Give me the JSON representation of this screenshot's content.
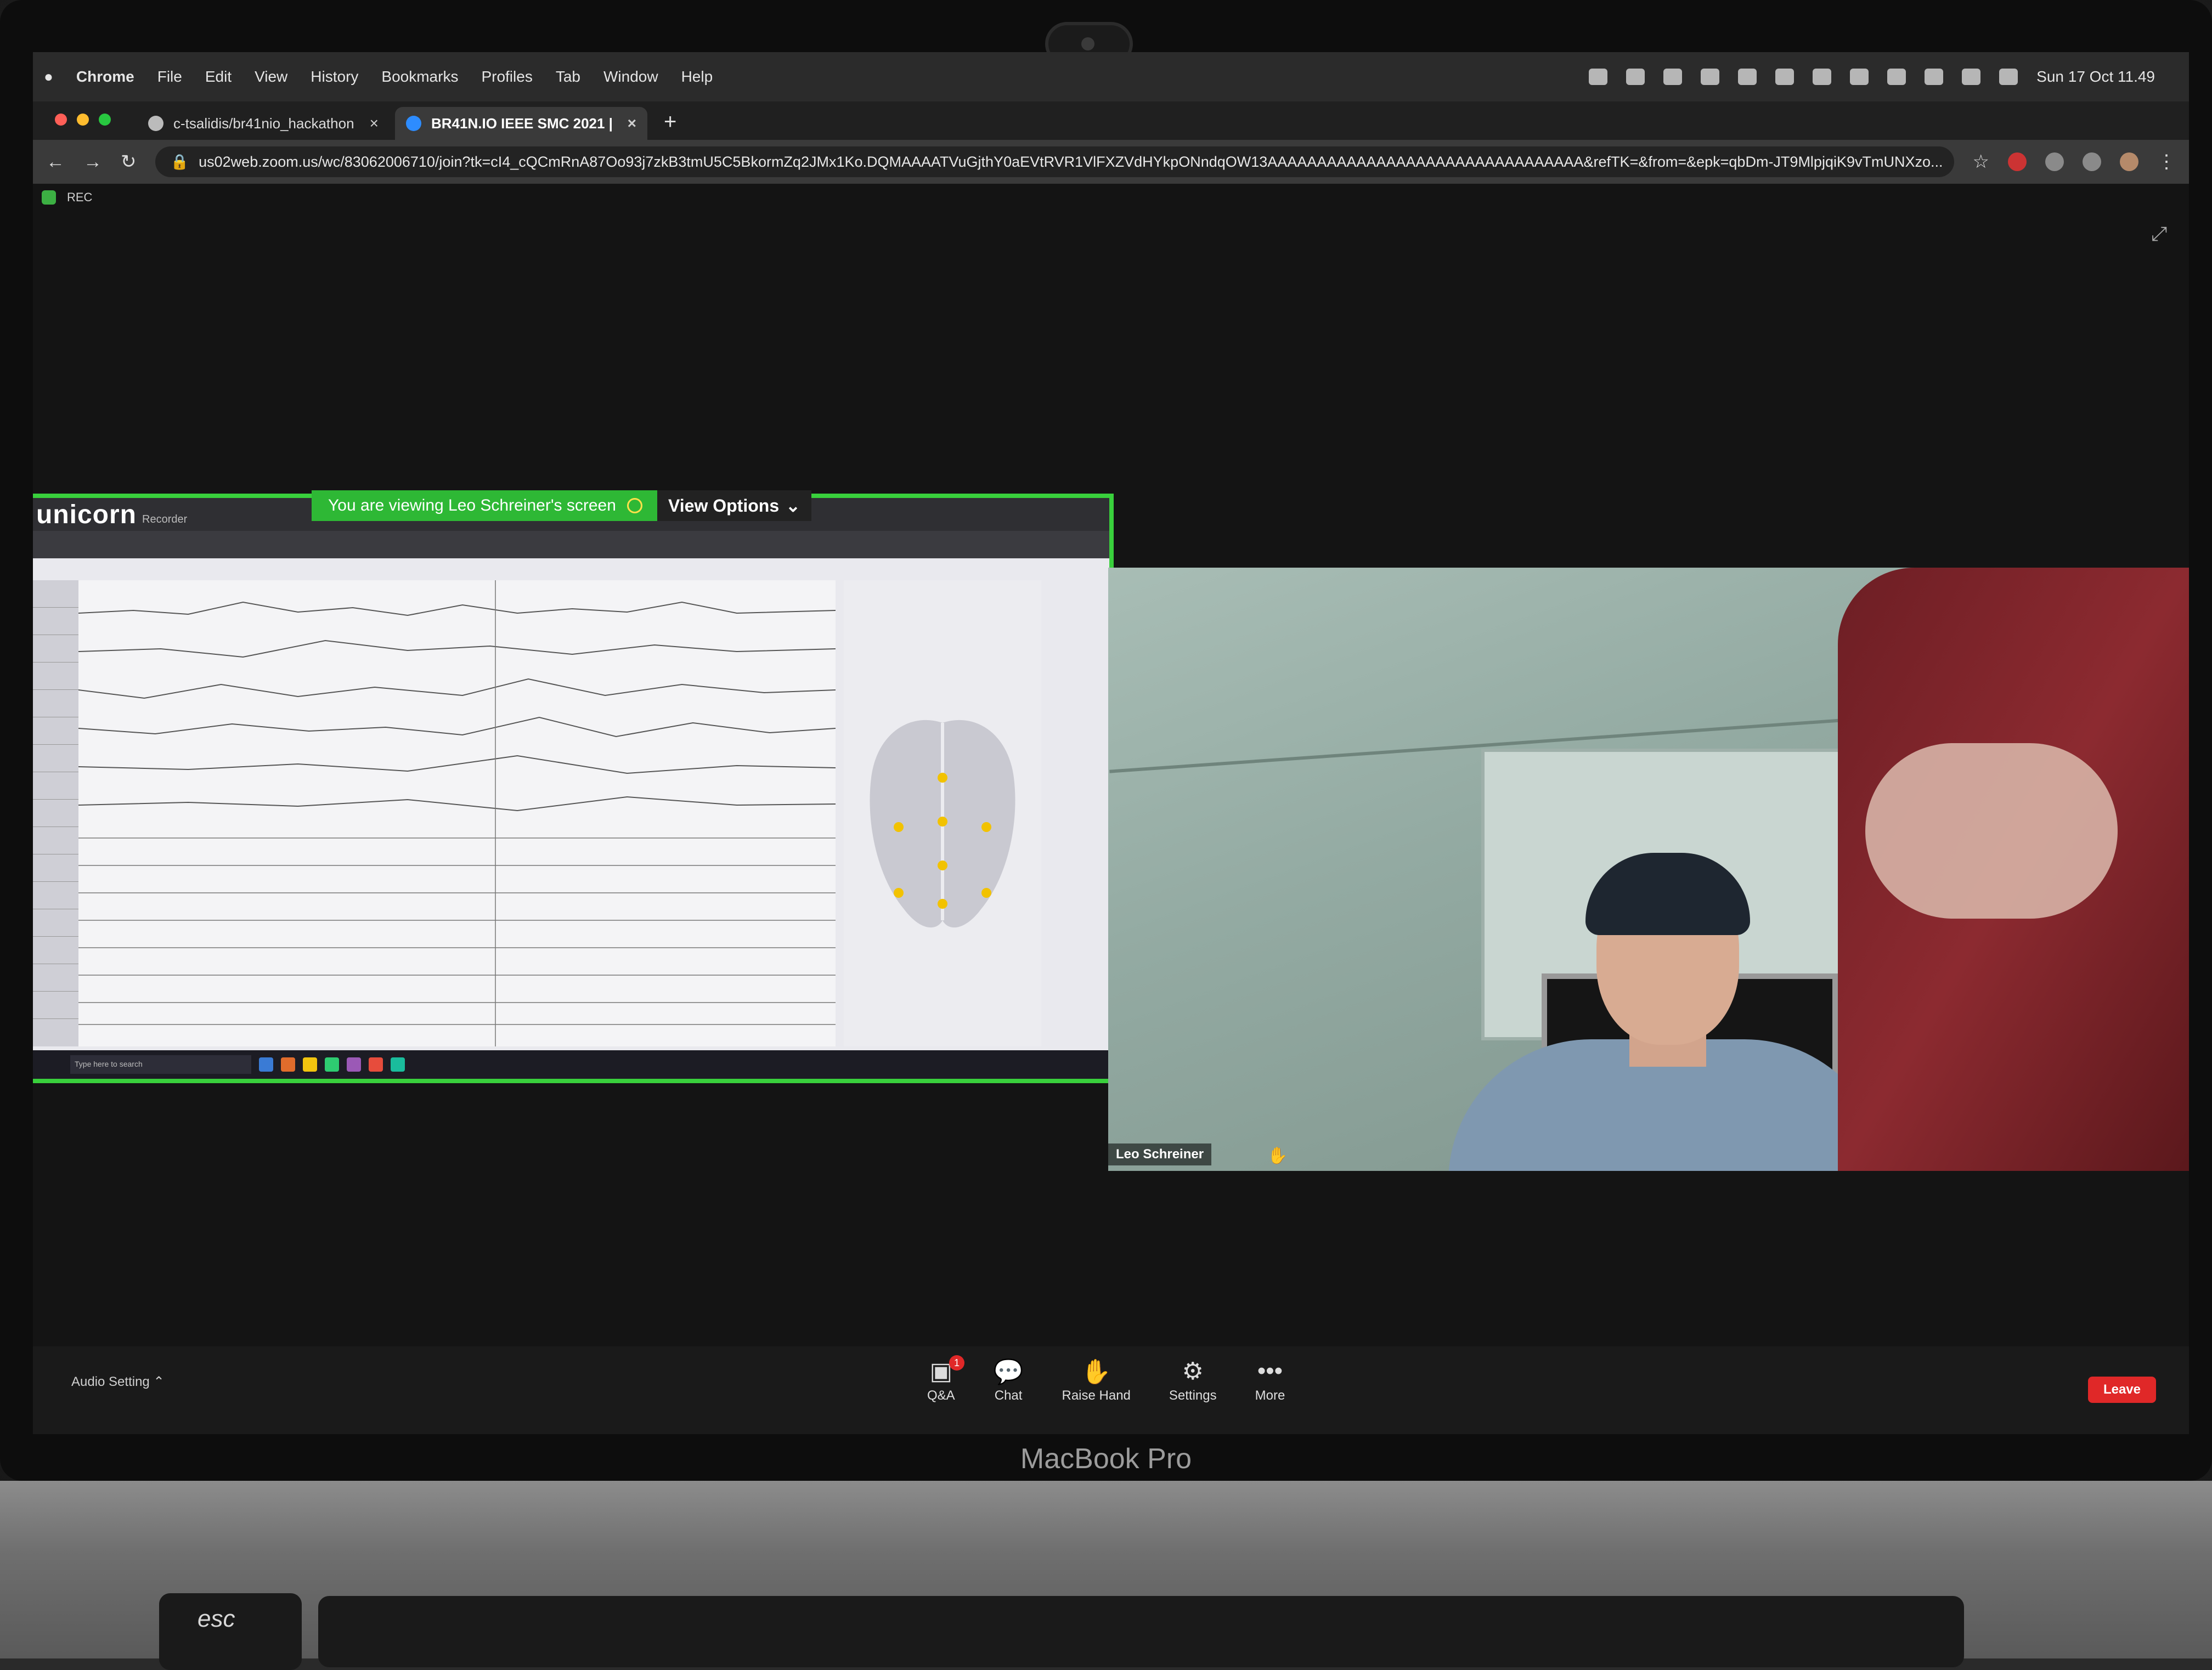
{
  "device": {
    "brand": "MacBook Pro",
    "esc_key": "esc"
  },
  "menubar": {
    "app": "Chrome",
    "items": [
      "File",
      "Edit",
      "View",
      "History",
      "Bookmarks",
      "Profiles",
      "Tab",
      "Window",
      "Help"
    ],
    "clock": "Sun 17 Oct  11.49"
  },
  "tabs": [
    {
      "label": "c-tsalidis/br41nio_hackathon",
      "close": "×"
    },
    {
      "label": "BR41N.IO IEEE SMC 2021 |",
      "close": "×"
    }
  ],
  "newtab": "+",
  "address": {
    "url": "us02web.zoom.us/wc/83062006710/join?tk=cI4_cQCmRnA87Oo93j7zkB3tmU5C5BkormZq2JMx1Ko.DQMAAAATVuGjthY0aEVtRVR1VlFXZVdHYkpONndqOW13AAAAAAAAAAAAAAAAAAAAAAAAAAAAAAAA&refTK=&from=&epk=qbDm-JT9MlpjqiK9vTmUNXzo..."
  },
  "meeting": {
    "rec": "REC",
    "share_banner": "You are viewing Leo Schreiner's screen",
    "view_options": "View Options",
    "participant_name": "Leo Schreiner"
  },
  "recorder": {
    "logo": "unicorn",
    "subtitle": "Recorder",
    "search_placeholder": "Type here to search"
  },
  "footer": {
    "audio_setting": "Audio Setting",
    "qa": {
      "label": "Q&A",
      "badge": "1"
    },
    "chat": "Chat",
    "raise_hand": "Raise Hand",
    "settings": "Settings",
    "more": "More",
    "leave": "Leave"
  }
}
